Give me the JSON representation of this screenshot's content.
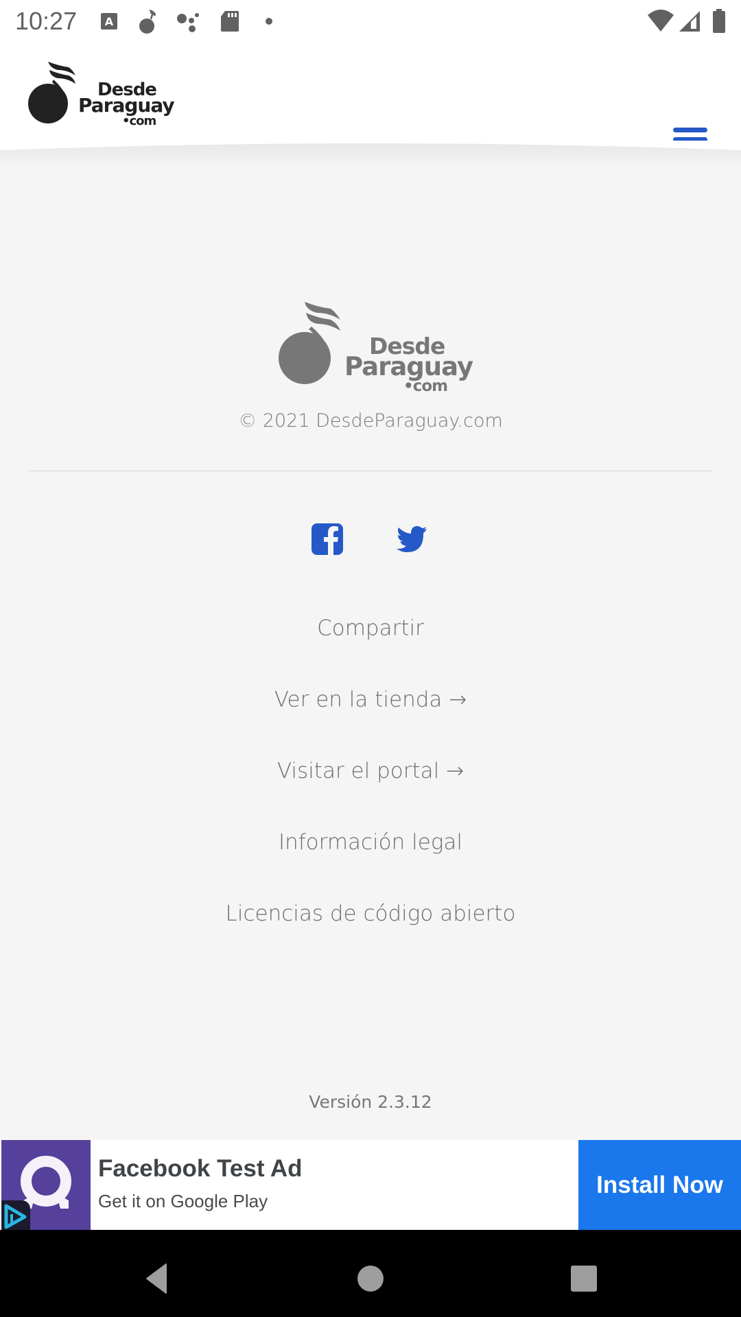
{
  "status_bar": {
    "time": "10:27",
    "left_icons": [
      "text-a-icon",
      "music-note-icon",
      "assistant-dots-icon",
      "sd-card-icon",
      "dot-icon"
    ],
    "right_icons": [
      "wifi-icon",
      "cell-signal-icon",
      "battery-icon"
    ]
  },
  "header": {
    "logo": {
      "line1": "Desde",
      "line2": "Paraguay",
      "line3": "•com"
    },
    "menu_icon": "hamburger-menu-icon",
    "accent_color": "#2459c7"
  },
  "footer": {
    "logo": {
      "line1": "Desde",
      "line2": "Paraguay",
      "line3": "•com"
    },
    "copyright": "© 2021 DesdeParaguay.com",
    "social": [
      {
        "name": "facebook",
        "icon": "facebook-icon"
      },
      {
        "name": "twitter",
        "icon": "twitter-icon"
      }
    ],
    "links": [
      {
        "label": "Compartir"
      },
      {
        "label": "Ver en la tienda →"
      },
      {
        "label": "Visitar el portal →"
      },
      {
        "label": "Información legal"
      },
      {
        "label": "Licencias de código abierto"
      }
    ],
    "version": "Versión 2.3.12"
  },
  "ad": {
    "title": "Facebook Test Ad",
    "subtitle": "Get it on Google Play",
    "cta": "Install Now",
    "cta_color": "#1a77ec",
    "icon_color": "#55409b"
  },
  "nav_bar": {
    "buttons": [
      "back",
      "home",
      "recents"
    ]
  }
}
